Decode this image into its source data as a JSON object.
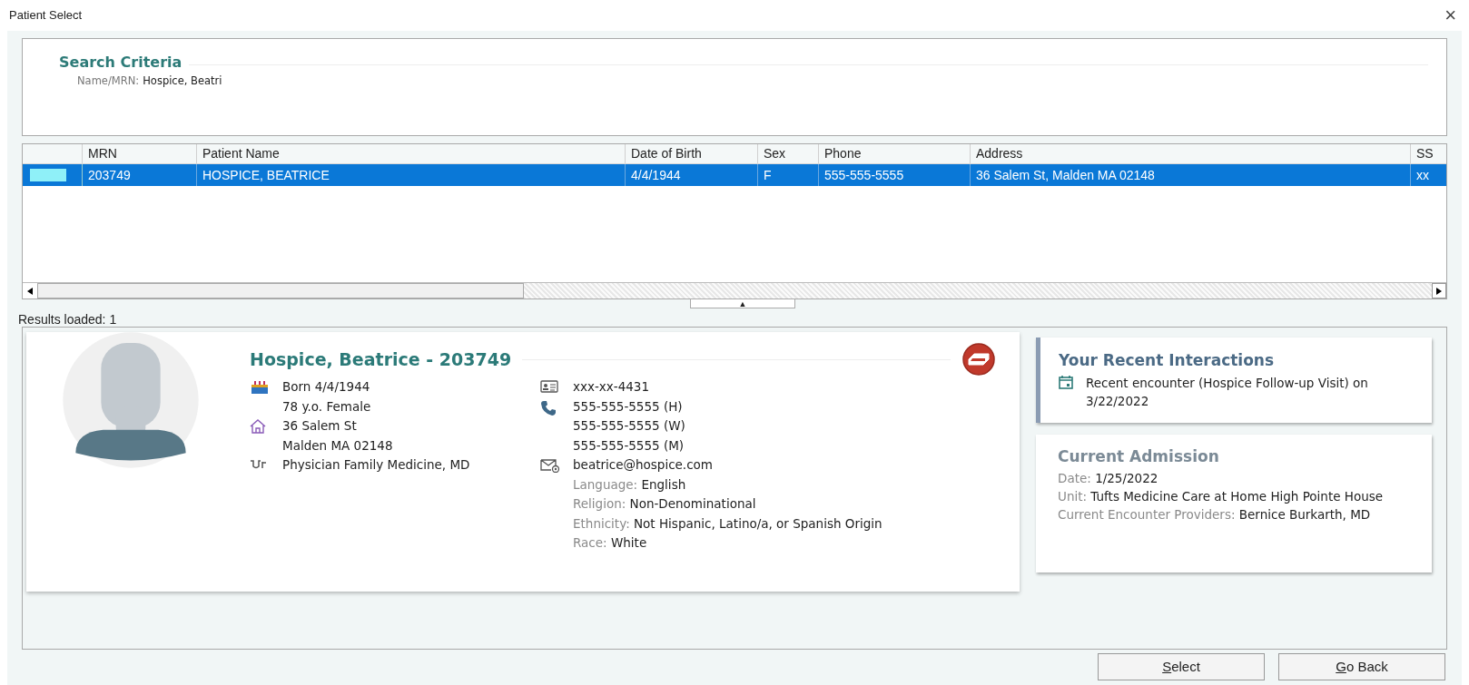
{
  "window": {
    "title": "Patient Select",
    "close": "×"
  },
  "search_criteria": {
    "title": "Search Criteria",
    "label": "Name/MRN:",
    "value": "Hospice, Beatri"
  },
  "table": {
    "columns": [
      "",
      "MRN",
      "Patient Name",
      "Date of Birth",
      "Sex",
      "Phone",
      "Address",
      "SS"
    ],
    "rows": [
      {
        "selected": true,
        "cells": [
          "",
          "203749",
          "HOSPICE, BEATRICE",
          "4/4/1944",
          "F",
          "555-555-5555",
          "36 Salem St, Malden MA 02148",
          "xx"
        ]
      }
    ]
  },
  "splitter": {
    "arrow": "▲"
  },
  "results": "Results loaded: 1",
  "patient": {
    "heading": "Hospice, Beatrice - 203749",
    "column_1": [
      {
        "kind": "birthday",
        "lines": [
          "Born 4/4/1944",
          "78 y.o. Female"
        ]
      },
      {
        "kind": "home",
        "lines": [
          "36 Salem St",
          "Malden MA 02148"
        ]
      },
      {
        "kind": "stethoscope",
        "lines": [
          "Physician Family Medicine, MD"
        ]
      }
    ],
    "column_2": [
      {
        "kind": "id",
        "lines": [
          "xxx-xx-4431"
        ]
      },
      {
        "kind": "phone",
        "lines": [
          "555-555-5555 (H)",
          "555-555-5555 (W)",
          "555-555-5555 (M)"
        ]
      },
      {
        "kind": "email",
        "lines": [
          "beatrice@hospice.com"
        ]
      }
    ],
    "demographics": [
      {
        "label": "Language:",
        "value": "English"
      },
      {
        "label": "Religion:",
        "value": "Non-Denominational"
      },
      {
        "label": "Ethnicity:",
        "value": "Not Hispanic, Latino/a, or Spanish Origin"
      },
      {
        "label": "Race:",
        "value": "White"
      }
    ]
  },
  "recent_interactions": {
    "title": "Your Recent Interactions",
    "items": [
      "Recent encounter (Hospice Follow-up Visit) on 3/22/2022"
    ]
  },
  "current_admission": {
    "title": "Current Admission",
    "fields": [
      {
        "label": "Date:",
        "value": "1/25/2022"
      },
      {
        "label": "Unit:",
        "value": "Tufts Medicine Care at Home High Pointe House"
      },
      {
        "label": "Current Encounter Providers:",
        "value": "Bernice Burkarth, MD"
      }
    ]
  },
  "buttons": [
    {
      "label": "Select",
      "underline_first": true
    },
    {
      "label": "Go Back",
      "underline_first": true
    }
  ]
}
